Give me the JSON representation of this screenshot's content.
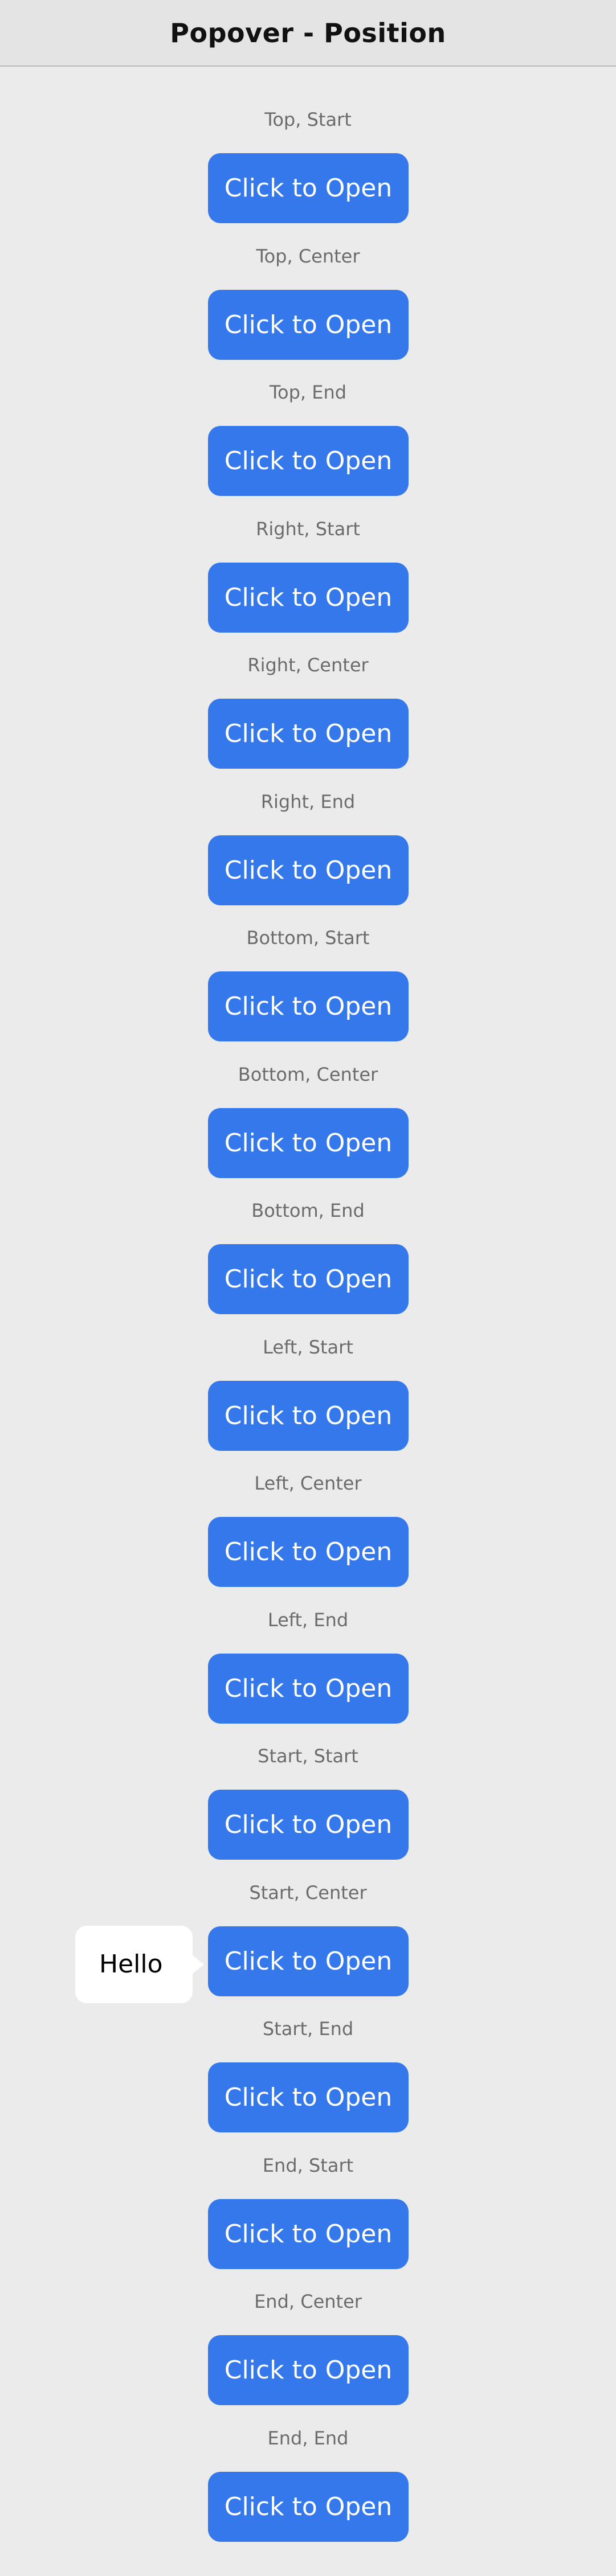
{
  "header": {
    "title": "Popover - Position"
  },
  "button_label": "Click to Open",
  "popover": {
    "text": "Hello",
    "open_index": 13
  },
  "items": [
    {
      "label": "Top, Start"
    },
    {
      "label": "Top, Center"
    },
    {
      "label": "Top, End"
    },
    {
      "label": "Right, Start"
    },
    {
      "label": "Right, Center"
    },
    {
      "label": "Right, End"
    },
    {
      "label": "Bottom, Start"
    },
    {
      "label": "Bottom, Center"
    },
    {
      "label": "Bottom, End"
    },
    {
      "label": "Left, Start"
    },
    {
      "label": "Left, Center"
    },
    {
      "label": "Left, End"
    },
    {
      "label": "Start, Start"
    },
    {
      "label": "Start, Center"
    },
    {
      "label": "Start, End"
    },
    {
      "label": "End, Start"
    },
    {
      "label": "End, Center"
    },
    {
      "label": "End, End"
    }
  ],
  "colors": {
    "button": "#3478eb",
    "background": "#ebebeb",
    "header": "#e4e4e4"
  }
}
